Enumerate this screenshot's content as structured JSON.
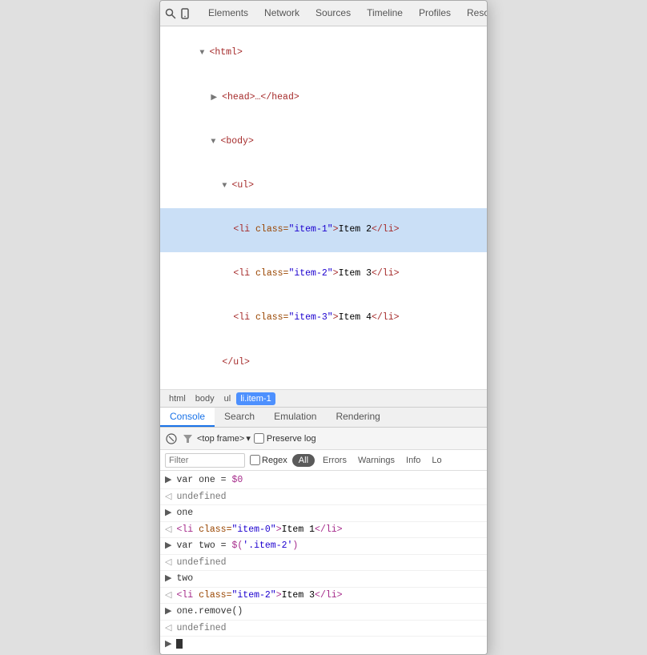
{
  "toolbar": {
    "search_icon": "🔍",
    "device_icon": "📱",
    "tabs": [
      {
        "label": "Elements",
        "active": false
      },
      {
        "label": "Network",
        "active": false
      },
      {
        "label": "Sources",
        "active": false
      },
      {
        "label": "Timeline",
        "active": false
      },
      {
        "label": "Profiles",
        "active": false
      },
      {
        "label": "Resou...",
        "active": false
      }
    ]
  },
  "elements": {
    "lines": [
      {
        "indent": 0,
        "content": "▼ <html>",
        "selected": false
      },
      {
        "indent": 1,
        "content": "▶ <head>…</head>",
        "selected": false
      },
      {
        "indent": 1,
        "content": "▼ <body>",
        "selected": false
      },
      {
        "indent": 2,
        "content": "▼ <ul>",
        "selected": false
      },
      {
        "indent": 3,
        "content": "<li class=\"item-1\">Item 2</li>",
        "selected": true
      },
      {
        "indent": 3,
        "content": "<li class=\"item-2\">Item 3</li>",
        "selected": false
      },
      {
        "indent": 3,
        "content": "<li class=\"item-3\">Item 4</li>",
        "selected": false
      },
      {
        "indent": 2,
        "content": "</ul>",
        "selected": false
      }
    ]
  },
  "breadcrumb": {
    "items": [
      {
        "label": "html",
        "active": false
      },
      {
        "label": "body",
        "active": false
      },
      {
        "label": "ul",
        "active": false
      },
      {
        "label": "li.item-1",
        "active": true
      }
    ]
  },
  "bottom_tabs": [
    {
      "label": "Console",
      "active": true
    },
    {
      "label": "Search",
      "active": false
    },
    {
      "label": "Emulation",
      "active": false
    },
    {
      "label": "Rendering",
      "active": false
    }
  ],
  "console_toolbar": {
    "clear_icon": "🚫",
    "filter_icon": "▽",
    "frame_label": "<top frame>",
    "dropdown_icon": "▾",
    "preserve_log_label": "Preserve log"
  },
  "console_filter": {
    "filter_placeholder": "Filter",
    "regex_label": "Regex",
    "levels": [
      "All",
      "Errors",
      "Warnings",
      "Info",
      "Lo"
    ]
  },
  "console_output": [
    {
      "type": "input",
      "arrow": ">",
      "text": "var one = $0"
    },
    {
      "type": "output",
      "arrow": "◁",
      "text": "undefined",
      "color": "gray"
    },
    {
      "type": "input",
      "arrow": ">",
      "text": "one"
    },
    {
      "type": "output",
      "arrow": "◁",
      "text_html": "<li class=\"item-0\">Item 1</li>",
      "color": "purple"
    },
    {
      "type": "input",
      "arrow": ">",
      "text": "var two = $('.item-2')"
    },
    {
      "type": "output",
      "arrow": "◁",
      "text": "undefined",
      "color": "gray"
    },
    {
      "type": "input",
      "arrow": ">",
      "text": "two"
    },
    {
      "type": "output",
      "arrow": "◁",
      "text_html": "<li class=\"item-2\">Item 3</li>",
      "color": "purple"
    },
    {
      "type": "input",
      "arrow": ">",
      "text": "one.remove()"
    },
    {
      "type": "output",
      "arrow": "◁",
      "text": "undefined",
      "color": "gray"
    },
    {
      "type": "prompt",
      "arrow": ">"
    }
  ]
}
